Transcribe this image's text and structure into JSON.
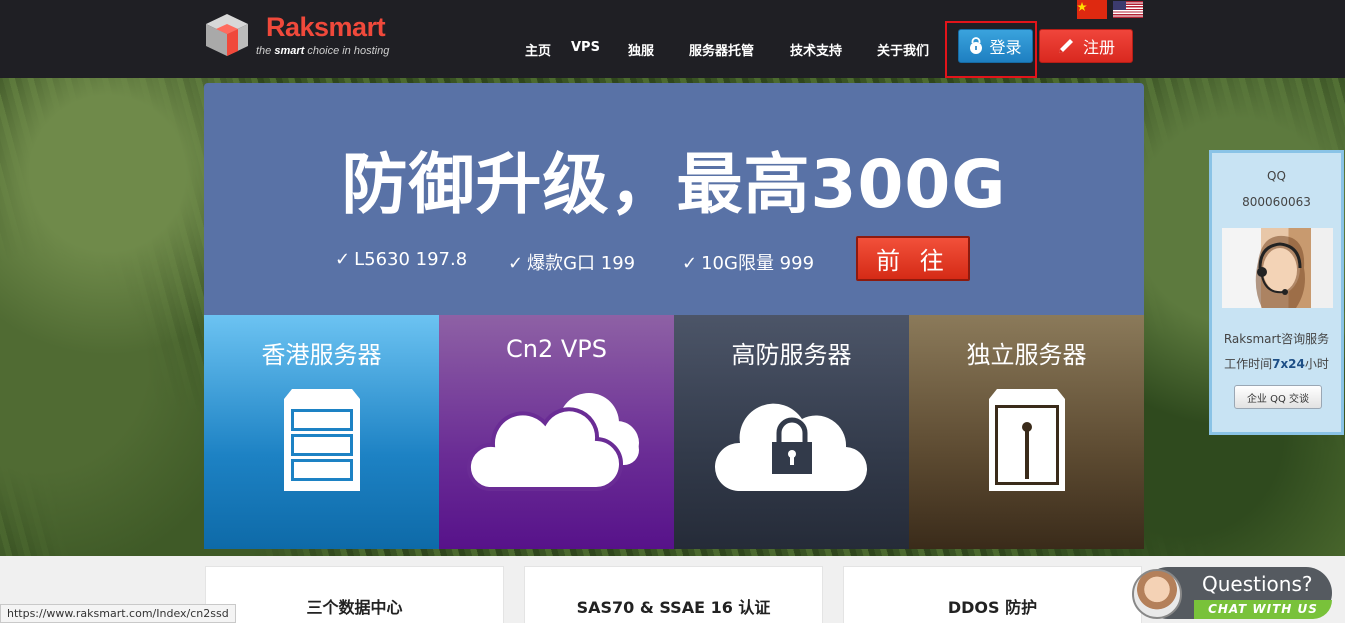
{
  "header": {
    "brand": "Raksmart",
    "tagline_prefix": "the ",
    "tagline_bold": "smart",
    "tagline_suffix": " choice in hosting",
    "nav": [
      {
        "label": "主页"
      },
      {
        "label": "VPS"
      },
      {
        "label": "独服"
      },
      {
        "label": "服务器托管"
      },
      {
        "label": "技术支持"
      },
      {
        "label": "关于我们"
      }
    ],
    "login_label": "登录",
    "register_label": "注册",
    "flags": [
      "cn-flag-icon",
      "us-flag-icon"
    ]
  },
  "banner": {
    "title": "防御升级，最高300G",
    "features": [
      {
        "check": "✓",
        "text": "L5630 197.8"
      },
      {
        "check": "✓",
        "text": "爆款G口 199"
      },
      {
        "check": "✓",
        "text": "10G限量 999"
      }
    ],
    "go_label": "前 往"
  },
  "tiles": [
    {
      "title": "香港服务器",
      "icon": "server-rack-icon"
    },
    {
      "title": "Cn2 VPS",
      "icon": "cloud-icon"
    },
    {
      "title": "高防服务器",
      "icon": "cloud-lock-icon"
    },
    {
      "title": "独立服务器",
      "icon": "server-box-icon"
    }
  ],
  "qq_panel": {
    "label": "QQ",
    "number": "800060063",
    "service_line1": "Raksmart咨询服务",
    "hours_prefix": "工作时间",
    "hours_bold": "7x24",
    "hours_suffix": "小时",
    "button_label": "企业 QQ 交谈"
  },
  "cards": [
    {
      "title": "三个数据中心"
    },
    {
      "title": "SAS70 & SSAE 16 认证"
    },
    {
      "title": "DDOS 防护"
    }
  ],
  "status_url": "https://www.raksmart.com/Index/cn2ssd",
  "chat": {
    "question": "Questions?",
    "cta": "CHAT WITH US"
  },
  "colors": {
    "header_bg": "#1f1f24",
    "banner_bg": "#5972a6",
    "brand_red": "#f0493b",
    "login_blue": "#1e7fc1",
    "register_red": "#d9281f",
    "tile_hk": "#1d82c4",
    "tile_cn2": "#6a2c95",
    "tile_ddos": "#323a4a",
    "tile_ded": "#5c4a31"
  }
}
